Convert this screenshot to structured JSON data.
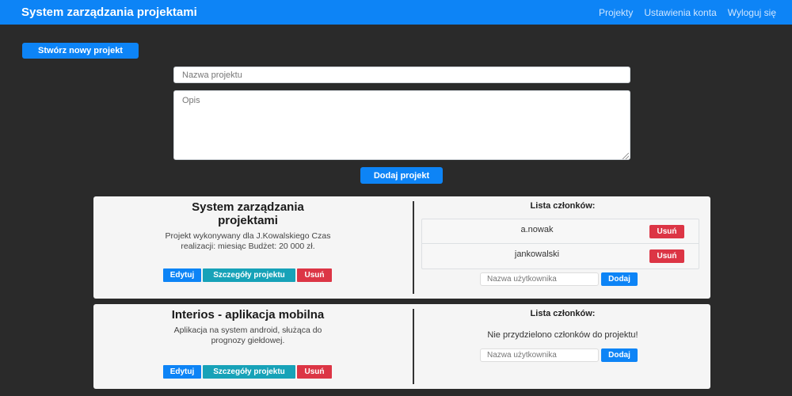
{
  "navbar": {
    "brand": "System zarządzania projektami",
    "links": [
      "Projekty",
      "Ustawienia konta",
      "Wyloguj się"
    ]
  },
  "create_button": "Stwórz nowy projekt",
  "form": {
    "name_placeholder": "Nazwa projektu",
    "desc_placeholder": "Opis",
    "submit_label": "Dodaj projekt"
  },
  "labels": {
    "edit": "Edytuj",
    "details": "Szczegóły projektu",
    "delete": "Usuń",
    "members_heading": "Lista członków:",
    "member_placeholder": "Nazwa użytkownika",
    "add_member": "Dodaj",
    "no_members": "Nie przydzielono członków do projektu!"
  },
  "projects": [
    {
      "title": "System zarządzania projektami",
      "description": "Projekt wykonywany dla J.Kowalskiego Czas realizacji: miesiąc Budżet: 20 000 zł.",
      "members": [
        "a.nowak",
        "jankowalski"
      ]
    },
    {
      "title": "Interios - aplikacja mobilna",
      "description": "Aplikacja na system android, służąca do prognozy giełdowej.",
      "members": []
    }
  ],
  "colors": {
    "primary": "#0d84f6",
    "info": "#17a2b8",
    "danger": "#dc3545",
    "background": "#2a2a2a",
    "card": "#f5f5f5"
  }
}
